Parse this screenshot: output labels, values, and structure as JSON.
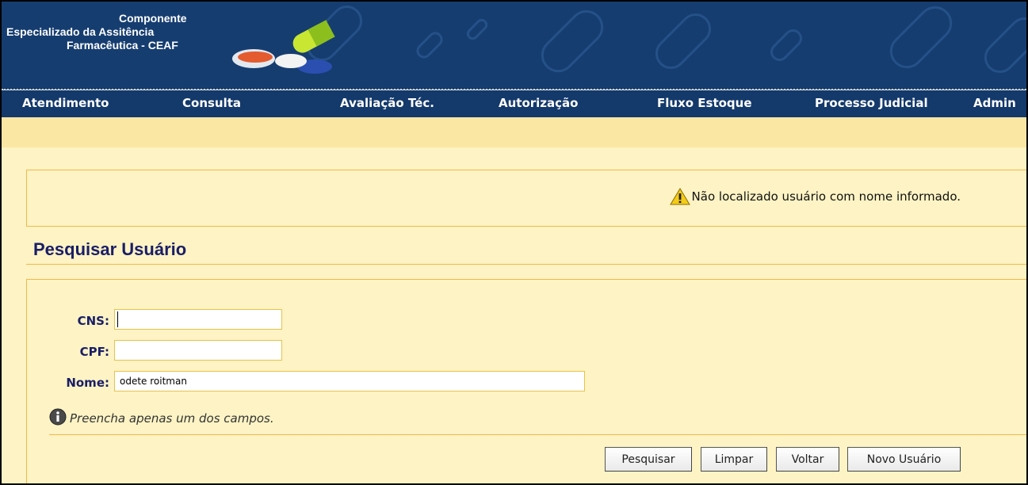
{
  "header": {
    "logo_line1": "Componente",
    "logo_line2": "Especializado da Assitência",
    "logo_line3": "Farmacêutica - CEAF"
  },
  "menu": [
    {
      "label": "Atendimento"
    },
    {
      "label": "Consulta"
    },
    {
      "label": "Avaliação Téc."
    },
    {
      "label": "Autorização"
    },
    {
      "label": "Fluxo Estoque"
    },
    {
      "label": "Processo Judicial"
    },
    {
      "label": "Admin"
    }
  ],
  "alert": {
    "icon": "warning-icon",
    "message": "Não localizado usuário com nome informado."
  },
  "page_title": "Pesquisar Usuário",
  "form": {
    "cns_label": "CNS:",
    "cns_value": "",
    "cpf_label": "CPF:",
    "cpf_value": "",
    "nome_label": "Nome:",
    "nome_value": "odete roitman"
  },
  "hint": {
    "icon": "info-icon",
    "text": "Preencha apenas um dos campos."
  },
  "buttons": {
    "search": "Pesquisar",
    "clear": "Limpar",
    "back": "Voltar",
    "new_user": "Novo Usuário"
  },
  "colors": {
    "header_bg": "#163d70",
    "page_bg": "#fdf3c4",
    "border_accent": "#f2b84a",
    "title_color": "#1a1e66"
  }
}
